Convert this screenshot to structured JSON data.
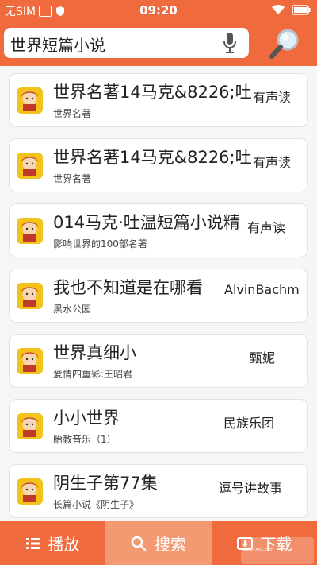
{
  "status_bar": {
    "carrier": "无SIM",
    "time": "09:20"
  },
  "search": {
    "query": "世界短篇小说"
  },
  "results": [
    {
      "title": "世界名著14马克&8226;吐",
      "subtitle": "世界名著",
      "author": "有声读"
    },
    {
      "title": "世界名著14马克&8226;吐",
      "subtitle": "世界名著",
      "author": "有声读"
    },
    {
      "title": "014马克·吐温短篇小说精",
      "subtitle": "影响世界的100部名著",
      "author": "有声读"
    },
    {
      "title": "我也不知道是在哪看",
      "subtitle": "黑水公园",
      "author": "AlvinBachm"
    },
    {
      "title": "世界真细小",
      "subtitle": "爱情四重彩:王昭君",
      "author": "甄妮"
    },
    {
      "title": "小小世界",
      "subtitle": "胎教音乐（1）",
      "author": "民族乐团"
    },
    {
      "title": "阴生子第77集",
      "subtitle": "长篇小说《阴生子》",
      "author": "逗号讲故事"
    }
  ],
  "tabs": {
    "play": "播放",
    "search": "搜索",
    "download": "下载"
  },
  "watermark": {
    "url": "www.FXXZ.com"
  },
  "colors": {
    "brand": "#ef6a3c",
    "active_tab": "#f49a73"
  }
}
